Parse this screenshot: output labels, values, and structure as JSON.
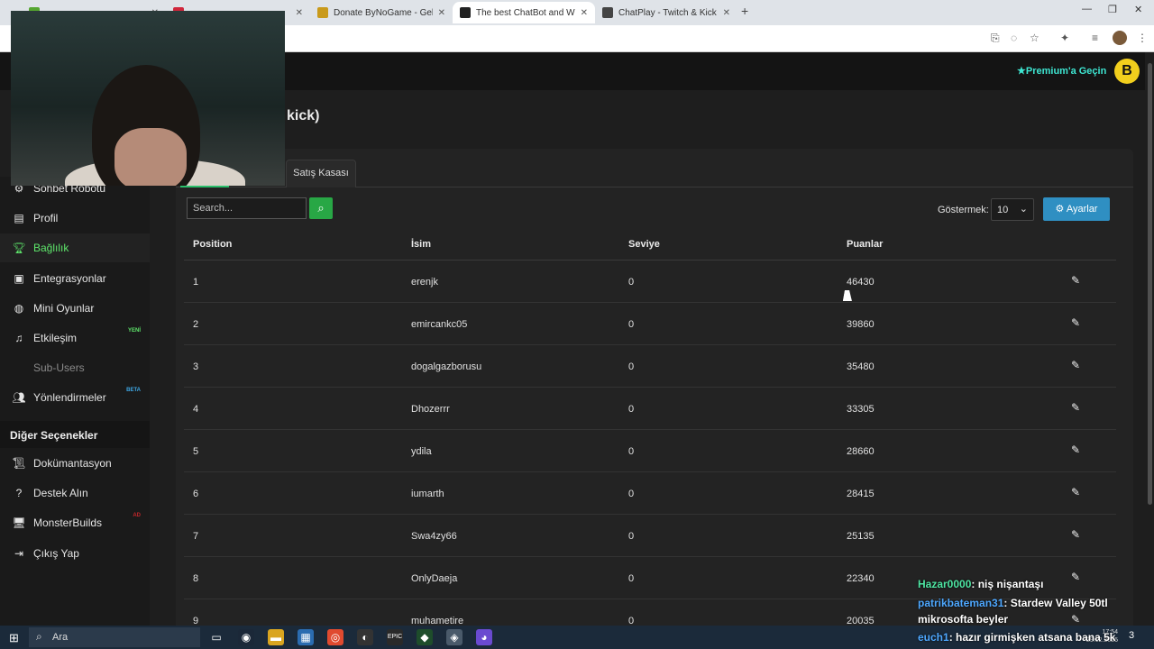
{
  "browser": {
    "tabs": [
      {
        "title": "",
        "favicon_color": "#55a630"
      },
      {
        "title": "",
        "favicon_color": "#d0263b"
      },
      {
        "title": "Donate ByNoGame - Gelen/Gid",
        "favicon_color": "#c99a1b"
      },
      {
        "title": "The best ChatBot and Widgets",
        "favicon_color": "#222222"
      },
      {
        "title": "ChatPlay - Twitch & Kick İzleyic",
        "favicon_color": "#444444"
      }
    ],
    "active_tab_index": 3,
    "new_tab_icon": "plus-icon"
  },
  "header": {
    "premium_label": "Premium'a Geçin",
    "premium_icon": "star-icon",
    "accent_color": "#3ee6d2"
  },
  "page": {
    "title_visible": "kick)"
  },
  "sidebar": {
    "items": [
      {
        "label": "Sohbet Robotu",
        "icon": "robot-icon",
        "badge": ""
      },
      {
        "label": "Profil",
        "icon": "id-card-icon",
        "badge": ""
      },
      {
        "label": "Bağlılık",
        "icon": "trophy-icon",
        "badge": "",
        "active": true
      },
      {
        "label": "Entegrasyonlar",
        "icon": "window-icon",
        "badge": ""
      },
      {
        "label": "Mini Oyunlar",
        "icon": "gamepad-icon",
        "badge": ""
      },
      {
        "label": "Etkileşim",
        "icon": "music-icon",
        "badge": "YENİ"
      },
      {
        "label": "Sub-Users",
        "icon": "",
        "badge": "",
        "muted": true
      },
      {
        "label": "Yönlendirmeler",
        "icon": "users-icon",
        "badge": "BETA"
      }
    ],
    "section_title": "Diğer Seçenekler",
    "other_items": [
      {
        "label": "Dokümantasyon",
        "icon": "scroll-icon",
        "badge": ""
      },
      {
        "label": "Destek Alın",
        "icon": "question-icon",
        "badge": ""
      },
      {
        "label": "MonsterBuilds",
        "icon": "monitor-icon",
        "badge": "AD"
      },
      {
        "label": "Çıkış Yap",
        "icon": "logout-icon",
        "badge": ""
      }
    ],
    "active_color": "#5ee66b"
  },
  "tabs": {
    "sales_tab": "Satış Kasası"
  },
  "toolbar": {
    "search_placeholder": "Search...",
    "show_label": "Göstermek:",
    "show_value": "10",
    "settings_label": "Ayarlar"
  },
  "table": {
    "headers": [
      "Position",
      "İsim",
      "Seviye",
      "Puanlar"
    ],
    "rows": [
      {
        "position": "1",
        "name": "erenjk",
        "level": "0",
        "points": "46430"
      },
      {
        "position": "2",
        "name": "emircankc05",
        "level": "0",
        "points": "39860"
      },
      {
        "position": "3",
        "name": "dogalgazborusu",
        "level": "0",
        "points": "35480"
      },
      {
        "position": "4",
        "name": "Dhozerrr",
        "level": "0",
        "points": "33305"
      },
      {
        "position": "5",
        "name": "ydila",
        "level": "0",
        "points": "28660"
      },
      {
        "position": "6",
        "name": "iumarth",
        "level": "0",
        "points": "28415"
      },
      {
        "position": "7",
        "name": "Swa4zy66",
        "level": "0",
        "points": "25135"
      },
      {
        "position": "8",
        "name": "OnlyDaeja",
        "level": "0",
        "points": "22340"
      },
      {
        "position": "9",
        "name": "muhametire",
        "level": "0",
        "points": "20035"
      }
    ]
  },
  "chat_overlay": [
    {
      "user": "Hazar0000",
      "text": ": niş nişantaşı",
      "user_color": "#4ee6a3"
    },
    {
      "user": "patrikbateman31",
      "text": ": Stardew Valley 50tl",
      "user_color": "#4ea8ff"
    },
    {
      "user": "",
      "text": "mikrosofta beyler",
      "user_color": "#ffffff"
    },
    {
      "user": "euch1",
      "text": ": hazır girmişken atsana bana 5k",
      "user_color": "#4ea8ff"
    }
  ],
  "taskbar": {
    "search_label": "Ara",
    "time": "17:54",
    "date": "29.12.2025",
    "notification_count": "3"
  }
}
